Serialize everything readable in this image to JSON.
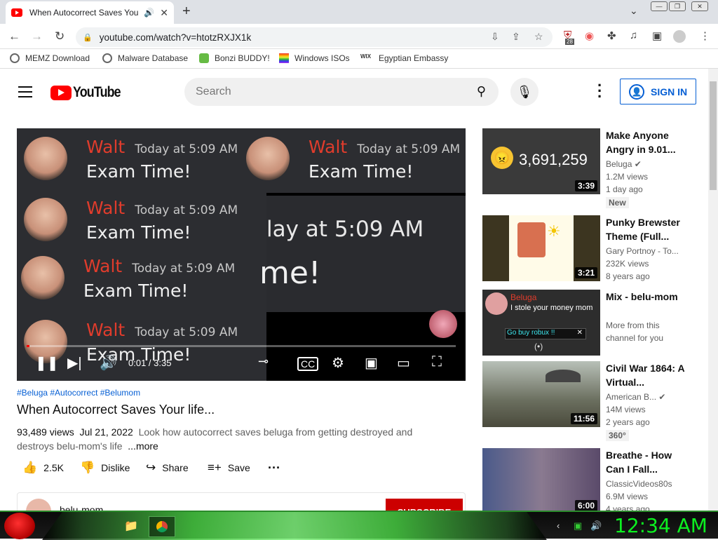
{
  "browser": {
    "tab_title": "When Autocorrect Saves You",
    "url": "youtube.com/watch?v=htotzRXJX1k",
    "extension_badge": "28",
    "bookmarks": [
      "MEMZ Download",
      "Malware Database",
      "Bonzi BUDDY!",
      "Windows ISOs",
      "Egyptian Embassy"
    ]
  },
  "youtube": {
    "logo": "YouTube",
    "search_placeholder": "Search",
    "sign_in": "SIGN IN"
  },
  "player": {
    "messages": [
      {
        "name": "Walt",
        "time": "Today at 5:09 AM",
        "text": "Exam Time!"
      },
      {
        "name": "Walt",
        "time": "Today at 5:09 AM",
        "text": "Exam Time!"
      },
      {
        "name": "Walt",
        "time": "Today at 5:09 AM",
        "text": "Exam Time!"
      },
      {
        "name": "Walt",
        "time": "Today at 5:09 AM",
        "text": "Exam Time!"
      },
      {
        "name": "Walt",
        "time": "Today at 5:09 AM",
        "text": "Exam Time!"
      },
      {
        "name": "Walt",
        "time": "Today at 5:09 AM",
        "text": "Exam Time!"
      }
    ],
    "zoom_time": "lay at 5:09 AM",
    "zoom_text": "me!",
    "current_time": "0:01 / 3:35",
    "progress": 0.005
  },
  "video": {
    "tags": "#Beluga #Autocorrect #Belumom",
    "title": "When Autocorrect Saves Your life...",
    "views": "93,489 views",
    "date": "Jul 21, 2022",
    "desc1": "Look how autocorrect saves beluga from getting destroyed and",
    "desc2": "destroys belu-mom's life",
    "more": "...more",
    "likes": "2.5K",
    "dislike": "Dislike",
    "share": "Share",
    "save": "Save",
    "channel": "belu-mom",
    "subscribe": "SUBSCRIBE"
  },
  "related": [
    {
      "title": "Make Anyone Angry in 9.01...",
      "channel": "Beluga",
      "views": "1.2M views",
      "age": "1 day ago",
      "badge": "New",
      "duration": "3:39",
      "thumb_text": "3,691,259"
    },
    {
      "title": "Punky Brewster Theme (Full...",
      "channel": "Gary Portnoy - To...",
      "views": "232K views",
      "age": "8 years ago",
      "badge": "",
      "duration": "3:21"
    },
    {
      "title": "Mix - belu-mom",
      "channel": "More from this",
      "views": "channel for you",
      "age": "",
      "badge": "",
      "duration": "",
      "mix_name": "Beluga",
      "mix_text": "I stole your money mom",
      "mix_popup": "Go buy robux !!"
    },
    {
      "title": "Civil War 1864: A Virtual...",
      "channel": "American B...",
      "views": "14M views",
      "age": "2 years ago",
      "badge": "360°",
      "duration": "11:56"
    },
    {
      "title": "Breathe - How Can I Fall...",
      "channel": "ClassicVideos80s",
      "views": "6.9M views",
      "age": "4 years ago",
      "badge": "",
      "duration": "6:00"
    }
  ],
  "taskbar": {
    "clock": "12:34 AM"
  }
}
